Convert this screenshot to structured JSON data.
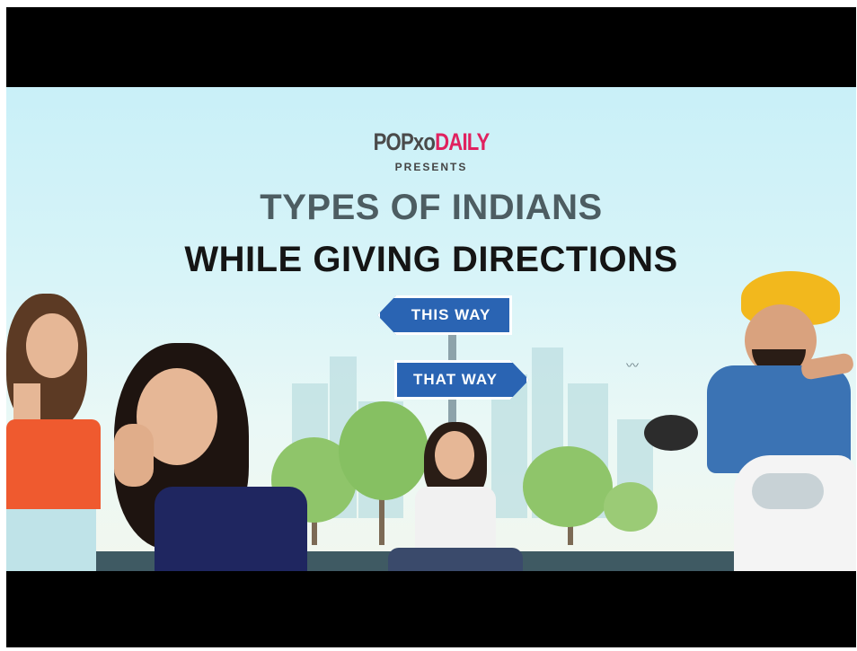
{
  "video": {
    "brand_pop": "POPxo",
    "brand_daily": "DAILY",
    "presents": "PRESENTS",
    "title_line1": "TYPES OF INDIANS",
    "title_line2": "WHILE GIVING DIRECTIONS",
    "sign_left": "THIS WAY",
    "sign_right": "THAT WAY"
  },
  "colors": {
    "brand_pink": "#e0215f",
    "sign_blue": "#2a64b3",
    "sky": "#c9f0f8"
  }
}
